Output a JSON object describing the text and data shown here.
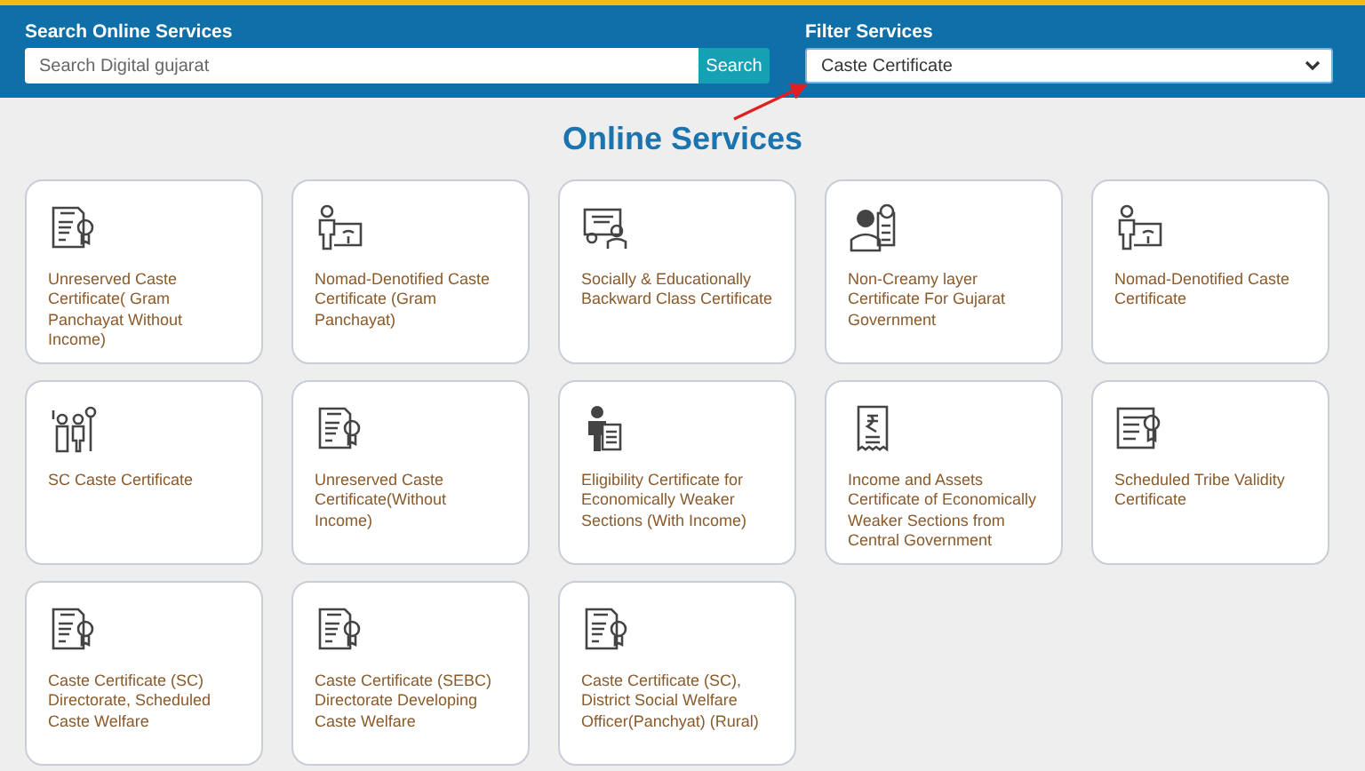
{
  "search": {
    "label": "Search Online Services",
    "placeholder": "Search Digital gujarat",
    "button": "Search"
  },
  "filter": {
    "label": "Filter Services",
    "value": "Caste Certificate"
  },
  "title": "Online Services",
  "cards": [
    {
      "kind": "certificate",
      "label": "Unreserved Caste Certificate( Gram Panchayat Without Income)"
    },
    {
      "kind": "board",
      "label": "Nomad-Denotified Caste Certificate (Gram Panchayat)"
    },
    {
      "kind": "class",
      "label": "Socially & Educationally Backward Class Certificate"
    },
    {
      "kind": "officer",
      "label": "Non-Creamy layer Certificate For Gujarat Government"
    },
    {
      "kind": "board",
      "label": "Nomad-Denotified Caste Certificate"
    },
    {
      "kind": "figures",
      "label": "SC Caste Certificate"
    },
    {
      "kind": "certificate",
      "label": "Unreserved Caste Certificate(Without Income)"
    },
    {
      "kind": "person-doc",
      "label": "Eligibility Certificate for Economically Weaker Sections (With Income)"
    },
    {
      "kind": "receipt",
      "label": "Income and Assets Certificate of Economically Weaker Sections from Central Government"
    },
    {
      "kind": "badge",
      "label": "Scheduled Tribe Validity Certificate"
    },
    {
      "kind": "certificate",
      "label": "Caste Certificate (SC) Directorate, Scheduled Caste Welfare"
    },
    {
      "kind": "certificate",
      "label": "Caste Certificate (SEBC) Directorate Developing Caste Welfare"
    },
    {
      "kind": "certificate",
      "label": "Caste Certificate (SC), District Social Welfare Officer(Panchyat) (Rural)"
    }
  ]
}
